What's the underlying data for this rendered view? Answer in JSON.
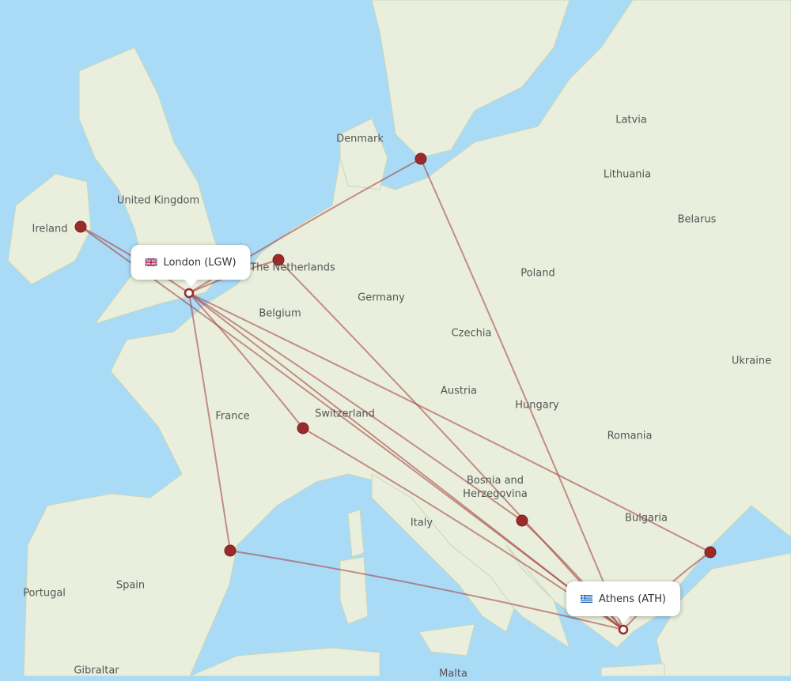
{
  "colors": {
    "sea": "#aadbf6",
    "land": "#e9efdc",
    "route": "#a33a3a",
    "marker": "#9b2a2a"
  },
  "origin": {
    "label": "London (LGW)",
    "flag": "uk-flag-icon"
  },
  "destination": {
    "label": "Athens (ATH)",
    "flag": "greece-flag-icon"
  },
  "countries": [
    {
      "name": "Latvia"
    },
    {
      "name": "Lithuania"
    },
    {
      "name": "Denmark"
    },
    {
      "name": "United Kingdom"
    },
    {
      "name": "Ireland"
    },
    {
      "name": "Belarus"
    },
    {
      "name": "The Netherlands"
    },
    {
      "name": "Poland"
    },
    {
      "name": "Germany"
    },
    {
      "name": "Belgium"
    },
    {
      "name": "Czechia"
    },
    {
      "name": "Ukraine"
    },
    {
      "name": "Austria"
    },
    {
      "name": "Hungary"
    },
    {
      "name": "France"
    },
    {
      "name": "Switzerland"
    },
    {
      "name": "Romania"
    },
    {
      "name": "Bosnia and Herzegovina"
    },
    {
      "name": "Italy"
    },
    {
      "name": "Bulgaria"
    },
    {
      "name": "Spain"
    },
    {
      "name": "Portugal"
    },
    {
      "name": "Gibraltar"
    },
    {
      "name": "Malta"
    }
  ]
}
